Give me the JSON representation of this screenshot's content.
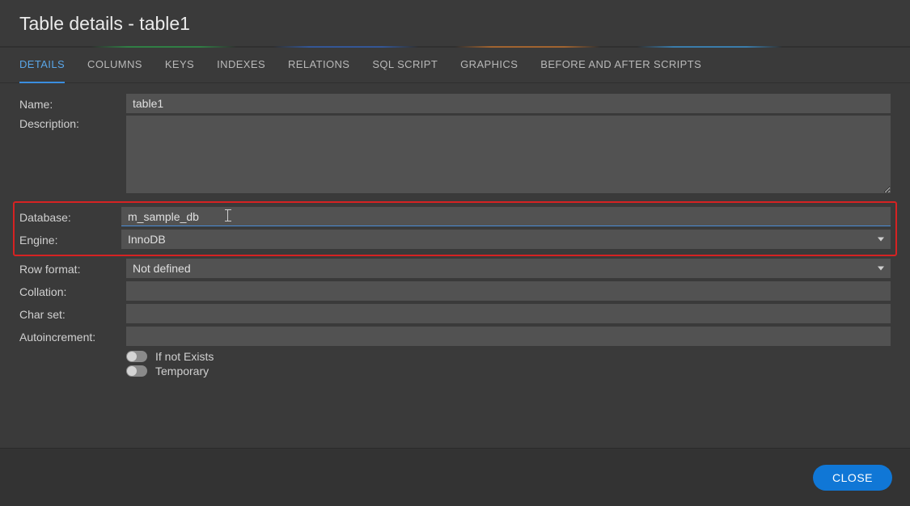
{
  "title": "Table details - table1",
  "tabs": [
    {
      "label": "DETAILS",
      "active": true
    },
    {
      "label": "COLUMNS"
    },
    {
      "label": "KEYS"
    },
    {
      "label": "INDEXES"
    },
    {
      "label": "RELATIONS"
    },
    {
      "label": "SQL SCRIPT"
    },
    {
      "label": "GRAPHICS"
    },
    {
      "label": "BEFORE AND AFTER SCRIPTS"
    }
  ],
  "labels": {
    "name": "Name:",
    "description": "Description:",
    "database": "Database:",
    "engine": "Engine:",
    "row_format": "Row format:",
    "collation": "Collation:",
    "char_set": "Char set:",
    "autoincrement": "Autoincrement:"
  },
  "fields": {
    "name": "table1",
    "description": "",
    "database": "m_sample_db",
    "engine": "InnoDB",
    "row_format": "Not defined",
    "collation": "",
    "char_set": "",
    "autoincrement": ""
  },
  "toggles": {
    "if_not_exists": {
      "label": "If not Exists",
      "on": false
    },
    "temporary": {
      "label": "Temporary",
      "on": false
    }
  },
  "footer": {
    "close": "CLOSE"
  }
}
